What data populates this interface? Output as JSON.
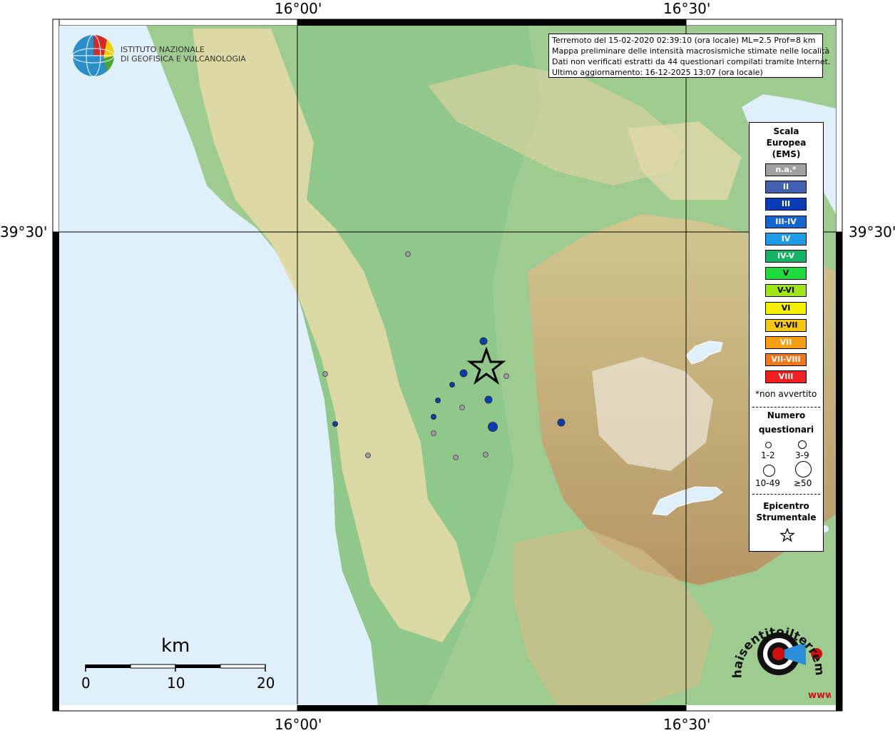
{
  "map": {
    "lon_labels": [
      "16°00'",
      "16°30'"
    ],
    "lat_labels": [
      "39°30'"
    ],
    "colors": {
      "sea": "#dff0fb",
      "frame": "#000000"
    }
  },
  "logo_ingv": {
    "line1": "ISTITUTO NAZIONALE",
    "line2": "DI GEOFISICA E VULCANOLOGIA"
  },
  "info": {
    "line1": "Terremoto del 15-02-2020 02:39:10 (ora locale) ML=2.5 Prof=8 km",
    "line2": "Mappa preliminare delle intensità macrosismiche stimate nelle località",
    "line3": "Dati non verificati estratti da 44 questionari compilati tramite Internet.",
    "line4": "Ultimo aggiornamento: 16-12-2025 13:07 (ora locale)"
  },
  "legend": {
    "title": [
      "Scala",
      "Europea",
      "(EMS)"
    ],
    "classes": [
      {
        "label": "n.a.*",
        "color": "#a0a0a0"
      },
      {
        "label": "II",
        "color": "#4060b0"
      },
      {
        "label": "III",
        "color": "#0a3cb8"
      },
      {
        "label": "III-IV",
        "color": "#1464d2"
      },
      {
        "label": "IV",
        "color": "#1e9be6"
      },
      {
        "label": "IV-V",
        "color": "#14b464"
      },
      {
        "label": "V",
        "color": "#1edc3c"
      },
      {
        "label": "V-VI",
        "color": "#a0e614"
      },
      {
        "label": "VI",
        "color": "#f5f000"
      },
      {
        "label": "VI-VII",
        "color": "#f5c814"
      },
      {
        "label": "VII",
        "color": "#f5a014"
      },
      {
        "label": "VII-VIII",
        "color": "#f0781e"
      },
      {
        "label": "VIII",
        "color": "#f01e1e"
      }
    ],
    "not_felt_note": "*non avvertito",
    "count_title": [
      "Numero",
      "questionari"
    ],
    "count_classes": [
      "1-2",
      "3-9",
      "10-49",
      "≥50"
    ],
    "epicenter_title": [
      "Epicentro",
      "Strumentale"
    ]
  },
  "scale_bar": {
    "title": "km",
    "ticks": [
      "0",
      "10",
      "20"
    ]
  },
  "brand": {
    "text": "haisentitoilterremoto.it",
    "url_text": "www."
  }
}
